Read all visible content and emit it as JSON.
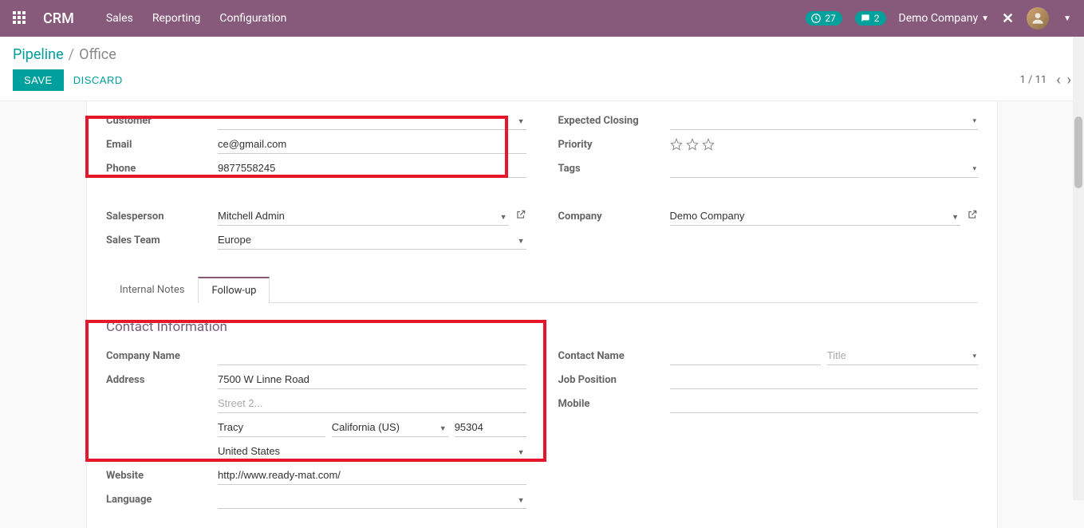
{
  "topbar": {
    "app_title": "CRM",
    "nav": [
      "Sales",
      "Reporting",
      "Configuration"
    ],
    "activity_count": "27",
    "message_count": "2",
    "company": "Demo Company"
  },
  "breadcrumb": {
    "parent": "Pipeline",
    "current": "Office"
  },
  "actions": {
    "save": "SAVE",
    "discard": "DISCARD",
    "pager": "1 / 11"
  },
  "form": {
    "left": {
      "customer_label": "Customer",
      "customer_value": "",
      "email_label": "Email",
      "email_value": "ce@gmail.com",
      "phone_label": "Phone",
      "phone_value": "9877558245",
      "salesperson_label": "Salesperson",
      "salesperson_value": "Mitchell Admin",
      "salesteam_label": "Sales Team",
      "salesteam_value": "Europe"
    },
    "right": {
      "expected_label": "Expected Closing",
      "expected_value": "",
      "priority_label": "Priority",
      "tags_label": "Tags",
      "tags_value": "",
      "company_label": "Company",
      "company_value": "Demo Company"
    }
  },
  "tabs": {
    "internal": "Internal Notes",
    "followup": "Follow-up"
  },
  "contact": {
    "section_title": "Contact Information",
    "company_name_label": "Company Name",
    "company_name_value": "",
    "address_label": "Address",
    "street1": "7500 W Linne Road",
    "street2_placeholder": "Street 2...",
    "city": "Tracy",
    "state": "California (US)",
    "zip": "95304",
    "country": "United States",
    "website_label": "Website",
    "website_value": "http://www.ready-mat.com/",
    "language_label": "Language",
    "language_value": "",
    "contact_name_label": "Contact Name",
    "contact_name_value": "",
    "title_placeholder": "Title",
    "job_label": "Job Position",
    "job_value": "",
    "mobile_label": "Mobile",
    "mobile_value": ""
  }
}
